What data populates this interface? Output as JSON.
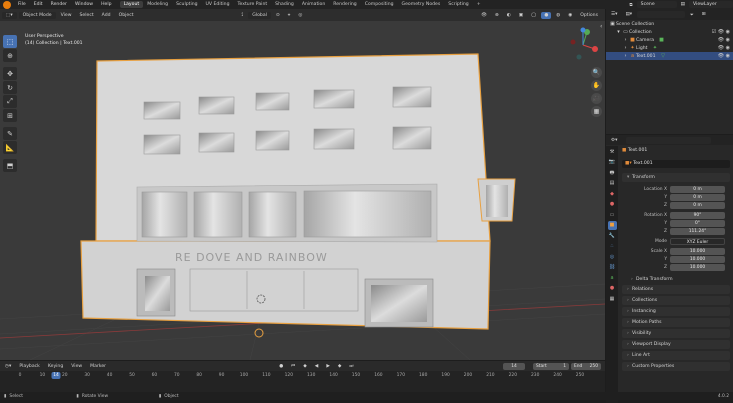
{
  "topbar": {
    "menus": [
      "File",
      "Edit",
      "Render",
      "Window",
      "Help"
    ],
    "workspaces": [
      "Layout",
      "Modeling",
      "Sculpting",
      "UV Editing",
      "Texture Paint",
      "Shading",
      "Animation",
      "Rendering",
      "Compositing",
      "Geometry Nodes",
      "Scripting"
    ],
    "active_workspace": "Layout",
    "scene": "Scene",
    "view_layer": "ViewLayer"
  },
  "viewport": {
    "mode": "Object Mode",
    "menus": [
      "View",
      "Select",
      "Add",
      "Object"
    ],
    "orientation": "Global",
    "options": "Options",
    "view_name": "User Perspective",
    "collection_info": "(14) Collection | Text.001",
    "sign_text": "RE DOVE AND RAINBOW",
    "accent": "#e8a040"
  },
  "timeline": {
    "menus": [
      "Playback",
      "Keying",
      "View",
      "Marker"
    ],
    "current_frame": "14",
    "start_label": "Start",
    "start": "1",
    "end_label": "End",
    "end": "250",
    "ticks": [
      "0",
      "10",
      "20",
      "30",
      "40",
      "50",
      "60",
      "70",
      "80",
      "90",
      "100",
      "110",
      "120",
      "130",
      "140",
      "150",
      "160",
      "170",
      "180",
      "190",
      "200",
      "210",
      "220",
      "230",
      "240",
      "250"
    ]
  },
  "statusbar": {
    "select": "Select",
    "rotate": "Rotate View",
    "object": "Object",
    "version": "4.0.2"
  },
  "outliner": {
    "scene_collection": "Scene Collection",
    "items": [
      {
        "name": "Collection",
        "icon": "collection-icon",
        "indent": 1
      },
      {
        "name": "Camera",
        "icon": "camera-icon",
        "indent": 2
      },
      {
        "name": "Light",
        "icon": "light-icon",
        "indent": 2
      },
      {
        "name": "Text.001",
        "icon": "text-object-icon",
        "indent": 2,
        "selected": true
      }
    ]
  },
  "properties": {
    "object_name": "Text.001",
    "data_name": "Text.001",
    "transform_title": "Transform",
    "location": {
      "label": "Location X",
      "x": "0 m",
      "y": "0 m",
      "z": "0 m"
    },
    "rotation": {
      "label": "Rotation X",
      "x": "90°",
      "y": "0°",
      "z": "111.24°"
    },
    "mode_label": "Mode",
    "mode": "XYZ Euler",
    "scale": {
      "label": "Scale X",
      "x": "10.000",
      "y": "10.000",
      "z": "10.000"
    },
    "axis_y": "Y",
    "axis_z": "Z",
    "panels": [
      "Delta Transform",
      "Relations",
      "Collections",
      "Instancing",
      "Motion Paths",
      "Visibility",
      "Viewport Display",
      "Line Art",
      "Custom Properties"
    ]
  }
}
